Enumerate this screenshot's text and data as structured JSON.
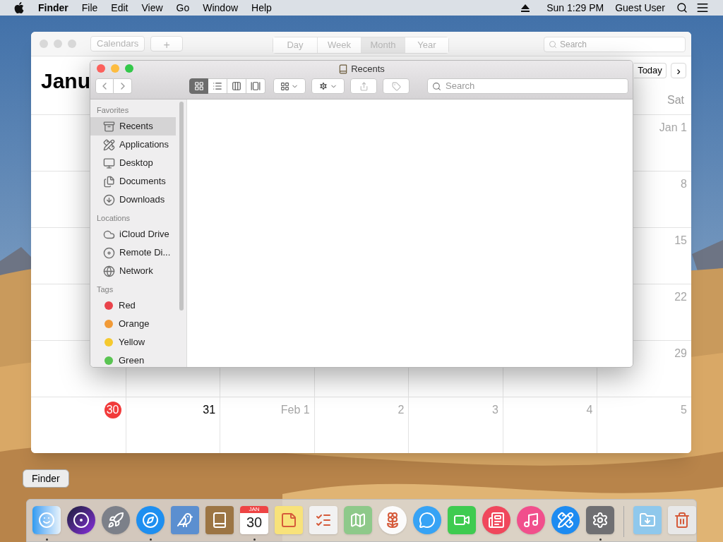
{
  "menu_bar": {
    "app": "Finder",
    "menus": [
      "File",
      "Edit",
      "View",
      "Go",
      "Window",
      "Help"
    ],
    "clock": "Sun 1:29 PM",
    "user": "Guest User"
  },
  "calendar": {
    "buttons": [
      "Calendars",
      "+"
    ],
    "view_tabs": [
      {
        "label": "Day",
        "selected": false
      },
      {
        "label": "Week",
        "selected": false
      },
      {
        "label": "Month",
        "selected": true
      },
      {
        "label": "Year",
        "selected": false
      }
    ],
    "search_placeholder": "Search",
    "title": "Janu",
    "today_button": "Today",
    "next_button": "›",
    "weekday": "Sat",
    "weeks": [
      {
        "days": [
          {
            "label": "Jan 1",
            "dim": true,
            "today": false
          }
        ]
      },
      {
        "days": [
          {
            "label": "8",
            "dim": true,
            "today": false
          }
        ]
      },
      {
        "days": [
          {
            "label": "15",
            "dim": true,
            "today": false
          }
        ]
      },
      {
        "days": [
          {
            "label": "22",
            "dim": true,
            "today": false
          }
        ]
      },
      {
        "days": [
          {
            "label": "29",
            "dim": true,
            "today": false
          }
        ]
      },
      {
        "days": [
          {
            "label": "30",
            "dim": false,
            "today": true
          },
          {
            "label": "31",
            "dim": false,
            "today": false
          },
          {
            "label": "Feb 1",
            "dim": true,
            "today": false
          },
          {
            "label": "2",
            "dim": true,
            "today": false
          },
          {
            "label": "3",
            "dim": true,
            "today": false
          },
          {
            "label": "4",
            "dim": true,
            "today": false
          },
          {
            "label": "5",
            "dim": true,
            "today": false
          }
        ]
      }
    ]
  },
  "finder": {
    "title": "Recents",
    "view_modes": [
      {
        "kind": "icons",
        "selected": true
      },
      {
        "kind": "list",
        "selected": false
      },
      {
        "kind": "columns",
        "selected": false
      },
      {
        "kind": "gallery",
        "selected": false
      }
    ],
    "search_placeholder": "Search",
    "sections": [
      {
        "title": "Favorites",
        "items": [
          {
            "label": "Recents",
            "kind": "recents",
            "selected": true
          },
          {
            "label": "Applications",
            "kind": "applications",
            "selected": false
          },
          {
            "label": "Desktop",
            "kind": "desktop",
            "selected": false
          },
          {
            "label": "Documents",
            "kind": "documents",
            "selected": false
          },
          {
            "label": "Downloads",
            "kind": "downloads",
            "selected": false
          }
        ]
      },
      {
        "title": "Locations",
        "items": [
          {
            "label": "iCloud Drive",
            "kind": "cloud",
            "selected": false
          },
          {
            "label": "Remote Di...",
            "kind": "disc",
            "selected": false
          },
          {
            "label": "Network",
            "kind": "network",
            "selected": false
          }
        ]
      },
      {
        "title": "Tags",
        "items": [
          {
            "label": "Red",
            "kind": "tag",
            "color": "#e9434b",
            "selected": false
          },
          {
            "label": "Orange",
            "kind": "tag",
            "color": "#f19a37",
            "selected": false
          },
          {
            "label": "Yellow",
            "kind": "tag",
            "color": "#f5c92e",
            "selected": false
          },
          {
            "label": "Green",
            "kind": "tag",
            "color": "#5ac452",
            "selected": false
          }
        ]
      }
    ]
  },
  "tooltip": "Finder",
  "dock": {
    "items": [
      {
        "kind": "finder",
        "running": true
      },
      {
        "kind": "siri",
        "running": false
      },
      {
        "kind": "launchpad",
        "running": false
      },
      {
        "kind": "safari",
        "running": true
      },
      {
        "kind": "mail",
        "running": false
      },
      {
        "kind": "contacts",
        "running": false
      },
      {
        "kind": "calendar",
        "running": true,
        "month": "JAN",
        "day": "30"
      },
      {
        "kind": "notes",
        "running": false
      },
      {
        "kind": "reminders",
        "running": false
      },
      {
        "kind": "maps",
        "running": false
      },
      {
        "kind": "photos",
        "running": false
      },
      {
        "kind": "messages",
        "running": false
      },
      {
        "kind": "facetime",
        "running": false
      },
      {
        "kind": "news",
        "running": false
      },
      {
        "kind": "music",
        "running": false
      },
      {
        "kind": "appstore",
        "running": false
      },
      {
        "kind": "preferences",
        "running": true
      },
      {
        "kind": "downloads",
        "running": false
      },
      {
        "kind": "trash",
        "running": false
      }
    ]
  }
}
